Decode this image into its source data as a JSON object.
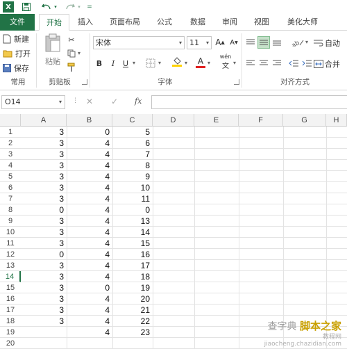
{
  "quick_access": {
    "app_icon": "excel-icon",
    "save_icon": "save-icon",
    "undo_icon": "undo-icon",
    "redo_icon": "redo-icon",
    "customize_icon": "customize-qat-icon"
  },
  "tabs": [
    "文件",
    "开始",
    "插入",
    "页面布局",
    "公式",
    "数据",
    "审阅",
    "视图",
    "美化大师"
  ],
  "ribbon": {
    "common_group": {
      "new_label": "新建",
      "open_label": "打开",
      "save_label": "保存",
      "group_label": "常用"
    },
    "clipboard_group": {
      "paste_label": "粘贴",
      "group_label": "剪贴板"
    },
    "font_group": {
      "font_name": "宋体",
      "font_size": "11",
      "grow": "A",
      "shrink": "A",
      "bold": "B",
      "italic": "I",
      "underline": "U",
      "fontcolor": "A",
      "phonetic": "wén",
      "group_label": "字体"
    },
    "alignment_group": {
      "wrap_label": "自动",
      "merge_label": "合并",
      "group_label": "对齐方式"
    }
  },
  "formula_bar": {
    "name_box": "O14",
    "cancel": "✕",
    "confirm": "✓",
    "fx": "fx",
    "formula": ""
  },
  "columns": [
    "A",
    "B",
    "C",
    "D",
    "E",
    "F",
    "G",
    "H"
  ],
  "rows": [
    {
      "n": "1",
      "a": "3",
      "b": "0",
      "c": "5"
    },
    {
      "n": "2",
      "a": "3",
      "b": "4",
      "c": "6"
    },
    {
      "n": "3",
      "a": "3",
      "b": "4",
      "c": "7"
    },
    {
      "n": "4",
      "a": "3",
      "b": "4",
      "c": "8"
    },
    {
      "n": "5",
      "a": "3",
      "b": "4",
      "c": "9"
    },
    {
      "n": "6",
      "a": "3",
      "b": "4",
      "c": "10"
    },
    {
      "n": "7",
      "a": "3",
      "b": "4",
      "c": "11"
    },
    {
      "n": "8",
      "a": "0",
      "b": "4",
      "c": "0"
    },
    {
      "n": "9",
      "a": "3",
      "b": "4",
      "c": "13"
    },
    {
      "n": "10",
      "a": "3",
      "b": "4",
      "c": "14"
    },
    {
      "n": "11",
      "a": "3",
      "b": "4",
      "c": "15"
    },
    {
      "n": "12",
      "a": "0",
      "b": "4",
      "c": "16"
    },
    {
      "n": "13",
      "a": "3",
      "b": "4",
      "c": "17"
    },
    {
      "n": "14",
      "a": "3",
      "b": "4",
      "c": "18"
    },
    {
      "n": "15",
      "a": "3",
      "b": "0",
      "c": "19"
    },
    {
      "n": "16",
      "a": "3",
      "b": "4",
      "c": "20"
    },
    {
      "n": "17",
      "a": "3",
      "b": "4",
      "c": "21"
    },
    {
      "n": "18",
      "a": "3",
      "b": "4",
      "c": "22"
    },
    {
      "n": "19",
      "a": "",
      "b": "4",
      "c": "23"
    },
    {
      "n": "20",
      "a": "",
      "b": "",
      "c": ""
    }
  ],
  "selected_row": "14",
  "watermark": {
    "line1": "查字典",
    "brand": "脚本之家",
    "line2": "教程网",
    "site": "jiaocheng.chazidian.com"
  },
  "colors": {
    "accent": "#217346",
    "font_color_bar": "#e02020",
    "fill_color_bar": "#ffd200"
  }
}
